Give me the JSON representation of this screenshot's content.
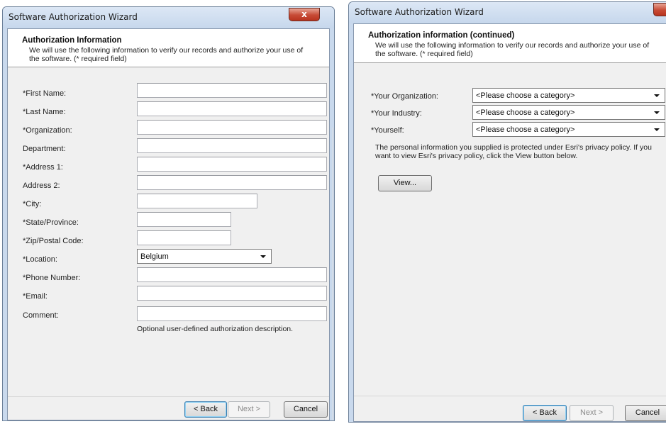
{
  "window1": {
    "title": "Software Authorization Wizard",
    "close_glyph": "x",
    "header": {
      "title": "Authorization Information",
      "description": "We will use the following information to verify our records and authorize your use of the software. (* required field)"
    },
    "fields": [
      {
        "label": "*First Name:",
        "value": ""
      },
      {
        "label": "*Last Name:",
        "value": ""
      },
      {
        "label": "*Organization:",
        "value": ""
      },
      {
        "label": "Department:",
        "value": ""
      },
      {
        "label": "*Address 1:",
        "value": ""
      },
      {
        "label": "Address 2:",
        "value": ""
      },
      {
        "label": "*City:",
        "value": ""
      },
      {
        "label": "*State/Province:",
        "value": ""
      },
      {
        "label": "*Zip/Postal Code:",
        "value": ""
      },
      {
        "label": "*Location:",
        "value": "Belgium"
      },
      {
        "label": "*Phone Number:",
        "value": ""
      },
      {
        "label": "*Email:",
        "value": ""
      },
      {
        "label": "Comment:",
        "value": ""
      }
    ],
    "comment_hint": "Optional user-defined authorization description.",
    "buttons": {
      "back": "< Back",
      "next": "Next >",
      "cancel": "Cancel"
    }
  },
  "window2": {
    "title": "Software Authorization Wizard",
    "header": {
      "title": "Authorization information (continued)",
      "description": "We will use the following information to verify our records and authorize your use of the software. (* required field)"
    },
    "fields": [
      {
        "label": "*Your Organization:",
        "value": "<Please choose a category>"
      },
      {
        "label": "*Your Industry:",
        "value": "<Please choose a category>"
      },
      {
        "label": "*Yourself:",
        "value": "<Please choose a category>"
      }
    ],
    "privacy_text": "The personal information you supplied is protected under Esri's privacy policy. If you want to view Esri's privacy policy, click the View button below.",
    "view_button": "View...",
    "buttons": {
      "back": "< Back",
      "next": "Next >",
      "cancel": "Cancel"
    }
  }
}
